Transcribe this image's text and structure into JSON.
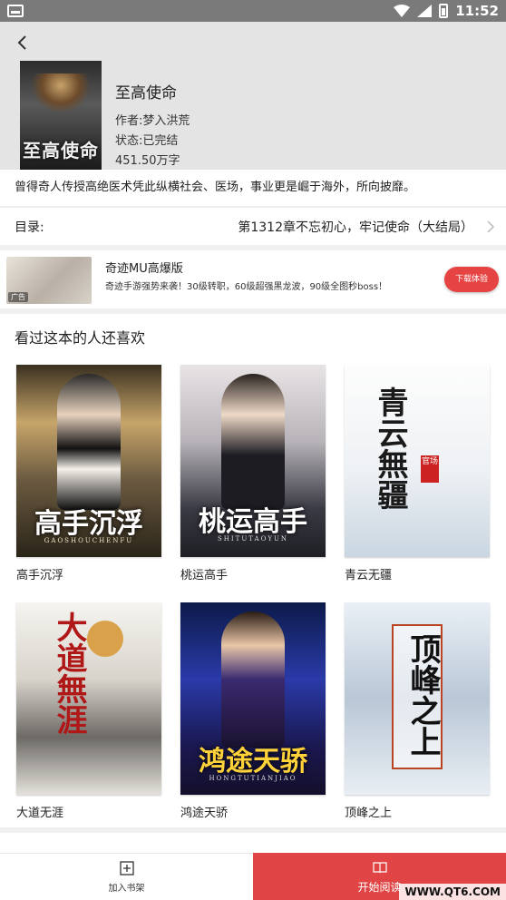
{
  "status_bar": {
    "time": "11:52"
  },
  "book": {
    "cover_text": "至高使命",
    "title": "至高使命",
    "author": "作者:梦入洪荒",
    "status": "状态:已完结",
    "word_count": "451.50万字",
    "description": "曾得奇人传授高绝医术凭此纵横社会、医场，事业更是崛于海外，所向披靡。"
  },
  "toc": {
    "label": "目录:",
    "latest_chapter": "第1312章不忘初心，牢记使命（大结局）"
  },
  "ad": {
    "title": "奇迹MU高爆版",
    "desc": "奇迹手游强势来袭！30级转职，60级超强黑龙波，90级全图秒boss！",
    "tag": "广告",
    "button": "下载体验"
  },
  "recommendations": {
    "heading": "看过这本的人还喜欢",
    "items": [
      {
        "title": "高手沉浮",
        "cover_text": "高手沉浮",
        "cover_sub": "GAOSHOUCHENFU"
      },
      {
        "title": "桃运高手",
        "cover_text": "桃运高手",
        "cover_sub": "SHITUTAOYUN"
      },
      {
        "title": "青云无疆",
        "cover_text": "青云無疆",
        "cover_sub": "官场"
      },
      {
        "title": "大道无涯",
        "cover_text": "大道無涯",
        "cover_sub": ""
      },
      {
        "title": "鸿途天骄",
        "cover_text": "鸿途天骄",
        "cover_sub": "HONGTUTIANJIAO"
      },
      {
        "title": "顶峰之上",
        "cover_text": "顶峰之上",
        "cover_sub": ""
      }
    ]
  },
  "bottom_bar": {
    "add_shelf": "加入书架",
    "start_read": "开始阅读"
  },
  "watermark": "WWW.QT6.COM",
  "colors": {
    "accent": "#e04444",
    "header_bg": "#e4e4e4"
  }
}
